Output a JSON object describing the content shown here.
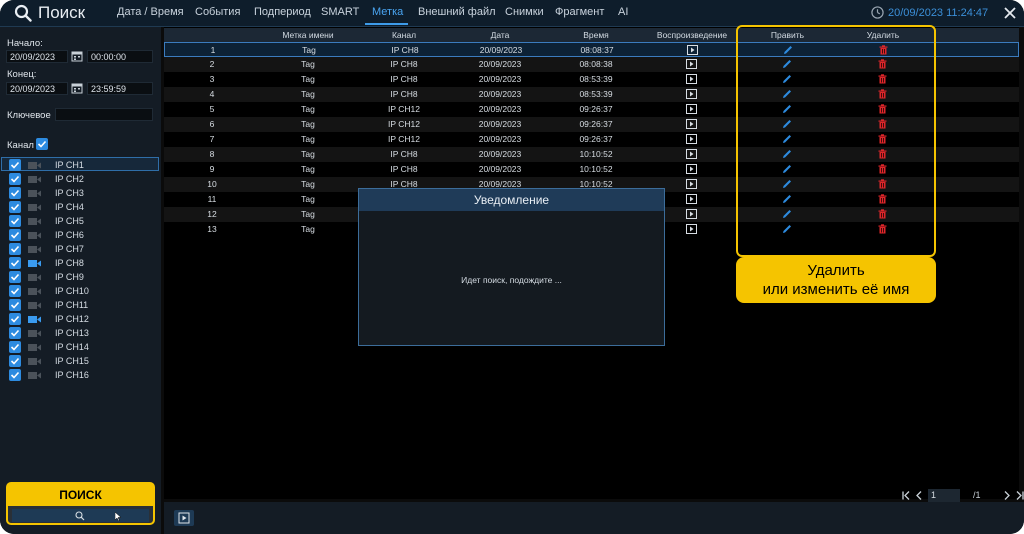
{
  "header": {
    "title": "Поиск",
    "tabs": [
      {
        "label": "Дата / Время",
        "active": false
      },
      {
        "label": "События",
        "active": false
      },
      {
        "label": "Подпериод",
        "active": false
      },
      {
        "label": "SMART",
        "active": false
      },
      {
        "label": "Метка",
        "active": true
      },
      {
        "label": "Внешний файл",
        "active": false
      },
      {
        "label": "Снимки",
        "active": false
      },
      {
        "label": "Фрагмент",
        "active": false
      },
      {
        "label": "AI",
        "active": false
      }
    ],
    "datetime": "20/09/2023 11:24:47"
  },
  "filters": {
    "start_label": "Начало:",
    "start_date": "20/09/2023",
    "start_time": "00:00:00",
    "end_label": "Конец:",
    "end_date": "20/09/2023",
    "end_time": "23:59:59",
    "keyword_label": "Ключевое",
    "keyword_value": "",
    "channel_label": "Канал"
  },
  "channels": [
    {
      "name": "IP CH1",
      "checked": true,
      "active": false
    },
    {
      "name": "IP CH2",
      "checked": true,
      "active": false
    },
    {
      "name": "IP CH3",
      "checked": true,
      "active": false
    },
    {
      "name": "IP CH4",
      "checked": true,
      "active": false
    },
    {
      "name": "IP CH5",
      "checked": true,
      "active": false
    },
    {
      "name": "IP CH6",
      "checked": true,
      "active": false
    },
    {
      "name": "IP CH7",
      "checked": true,
      "active": false
    },
    {
      "name": "IP CH8",
      "checked": true,
      "active": true
    },
    {
      "name": "IP CH9",
      "checked": true,
      "active": false
    },
    {
      "name": "IP CH10",
      "checked": true,
      "active": false
    },
    {
      "name": "IP CH11",
      "checked": true,
      "active": false
    },
    {
      "name": "IP CH12",
      "checked": true,
      "active": true
    },
    {
      "name": "IP CH13",
      "checked": true,
      "active": false
    },
    {
      "name": "IP CH14",
      "checked": true,
      "active": false
    },
    {
      "name": "IP CH15",
      "checked": true,
      "active": false
    },
    {
      "name": "IP CH16",
      "checked": true,
      "active": false
    }
  ],
  "search_callout": "ПОИСК",
  "table": {
    "columns": [
      "Метка имени",
      "Канал",
      "Дата",
      "Время",
      "Воспроизведение",
      "Править",
      "Удалить"
    ],
    "rows": [
      {
        "no": "1",
        "name": "Tag",
        "channel": "IP CH8",
        "date": "20/09/2023",
        "time": "08:08:37"
      },
      {
        "no": "2",
        "name": "Tag",
        "channel": "IP CH8",
        "date": "20/09/2023",
        "time": "08:08:38"
      },
      {
        "no": "3",
        "name": "Tag",
        "channel": "IP CH8",
        "date": "20/09/2023",
        "time": "08:53:39"
      },
      {
        "no": "4",
        "name": "Tag",
        "channel": "IP CH8",
        "date": "20/09/2023",
        "time": "08:53:39"
      },
      {
        "no": "5",
        "name": "Tag",
        "channel": "IP CH12",
        "date": "20/09/2023",
        "time": "09:26:37"
      },
      {
        "no": "6",
        "name": "Tag",
        "channel": "IP CH12",
        "date": "20/09/2023",
        "time": "09:26:37"
      },
      {
        "no": "7",
        "name": "Tag",
        "channel": "IP CH12",
        "date": "20/09/2023",
        "time": "09:26:37"
      },
      {
        "no": "8",
        "name": "Tag",
        "channel": "IP CH8",
        "date": "20/09/2023",
        "time": "10:10:52"
      },
      {
        "no": "9",
        "name": "Tag",
        "channel": "IP CH8",
        "date": "20/09/2023",
        "time": "10:10:52"
      },
      {
        "no": "10",
        "name": "Tag",
        "channel": "IP CH8",
        "date": "20/09/2023",
        "time": "10:10:52"
      },
      {
        "no": "11",
        "name": "Tag",
        "channel": "",
        "date": "",
        "time": ""
      },
      {
        "no": "12",
        "name": "Tag",
        "channel": "",
        "date": "",
        "time": ""
      },
      {
        "no": "13",
        "name": "Tag",
        "channel": "",
        "date": "",
        "time": ""
      }
    ]
  },
  "pagination": {
    "current": "1",
    "total": "/1"
  },
  "notice": {
    "title": "Уведомление",
    "message": "Идет поиск, подождите ..."
  },
  "annotation": {
    "line1": "Удалить",
    "line2": "или изменить её имя"
  },
  "colors": {
    "accent": "#2d8be0",
    "callout": "#f5c400",
    "delete": "#e0262a"
  },
  "icons": {
    "search": "search-icon",
    "clock": "clock-icon",
    "close": "close-icon",
    "calendar": "calendar-icon",
    "camera": "camera-icon",
    "play": "play-icon",
    "edit": "pencil-icon",
    "delete": "trash-icon",
    "checkbox": "checkbox-icon"
  }
}
